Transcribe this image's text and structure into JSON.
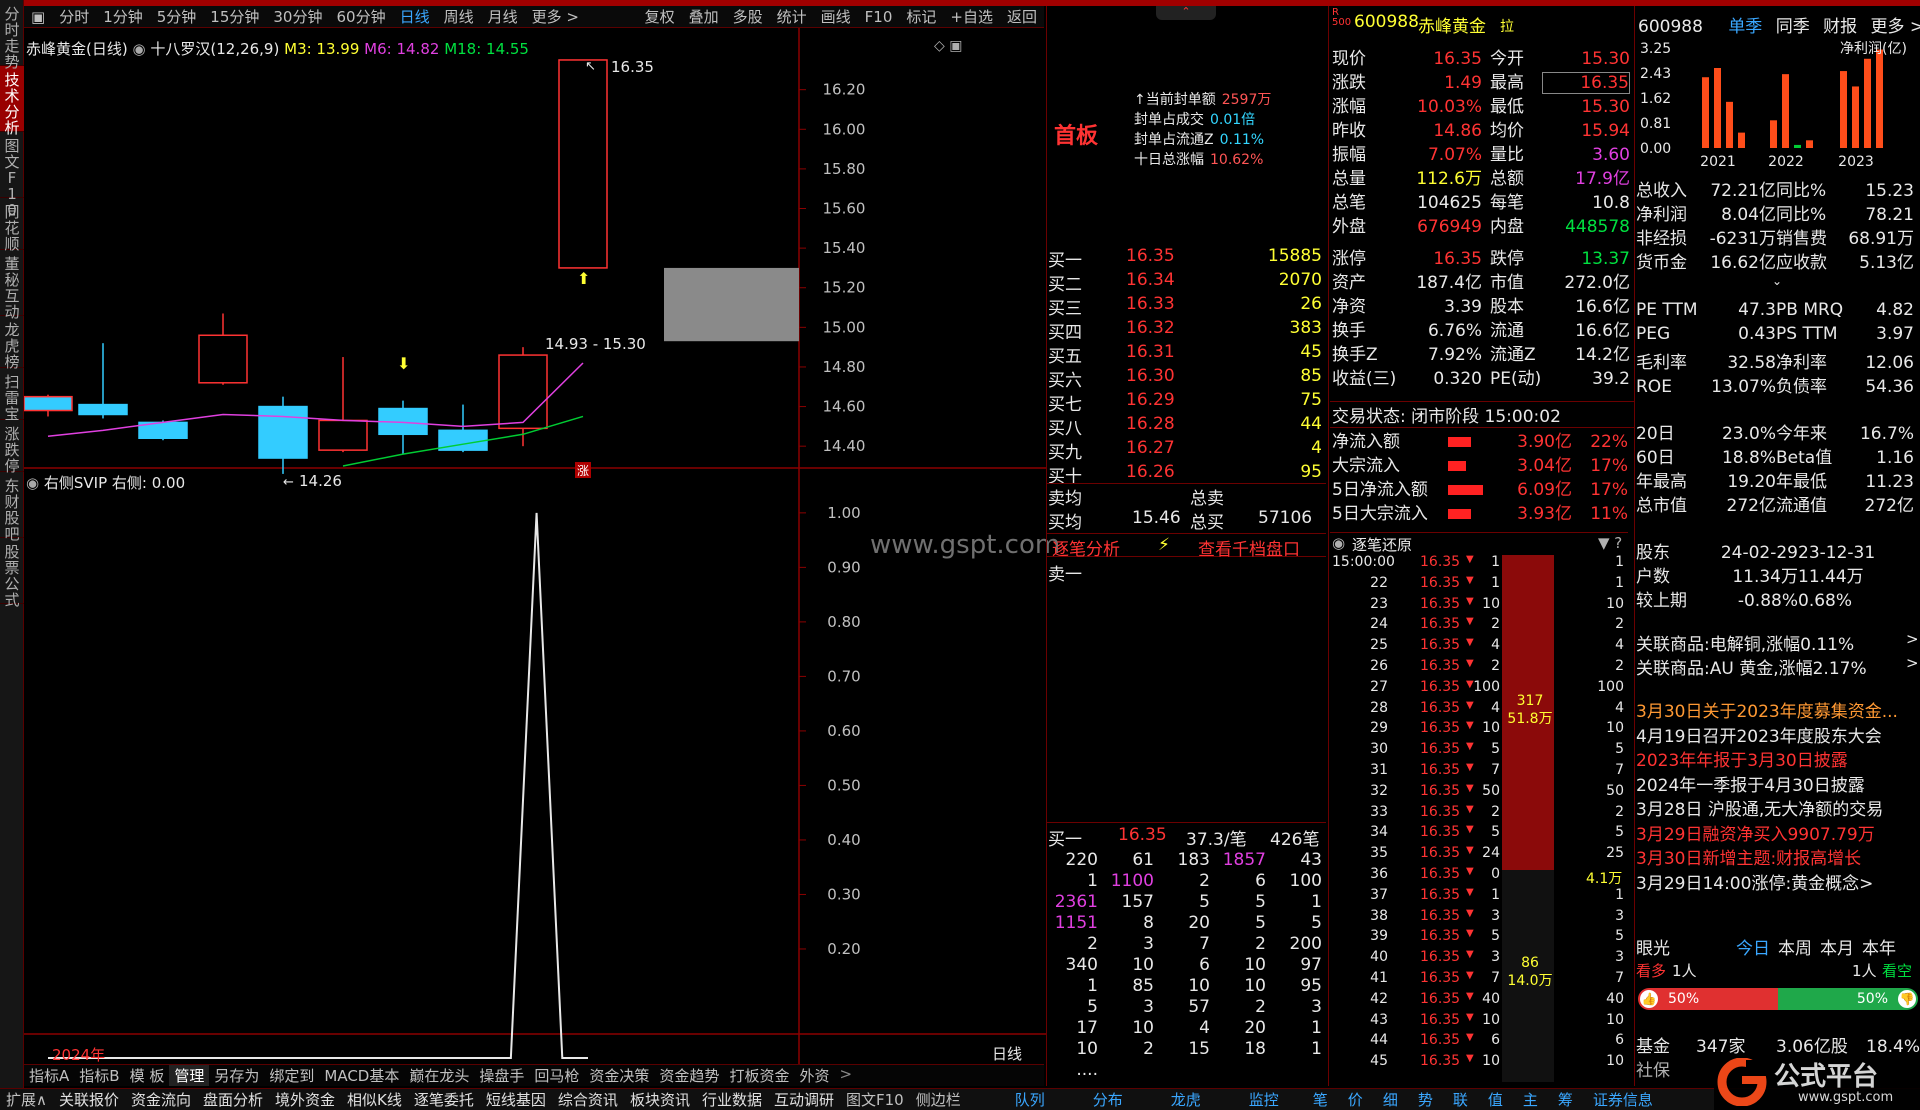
{
  "sidebar": [
    "分时走势",
    "技术分析",
    "图文F10",
    "同花顺",
    "董秘互动",
    "龙虎榜",
    "扫雷宝",
    "涨跌停",
    "东财股吧",
    "股票公式"
  ],
  "toolbar": {
    "periods": [
      "分时",
      "1分钟",
      "5分钟",
      "15分钟",
      "30分钟",
      "60分钟",
      "日线",
      "周线",
      "月线",
      "更多 >"
    ],
    "actions": [
      "复权",
      "叠加",
      "多股",
      "统计",
      "画线",
      "F10",
      "标记",
      "+自选",
      "返回"
    ]
  },
  "chart_header": {
    "title": "赤峰黄金(日线)",
    "indicator": "十八罗汉(12,26,9)",
    "m3": "M3: 13.99",
    "m6": "M6: 14.82",
    "m18": "M18: 14.55"
  },
  "chart_data": [
    {
      "type": "candlestick",
      "title": "赤峰黄金(日线)",
      "y_ticks": [
        "16.20",
        "16.00",
        "15.80",
        "15.60",
        "15.40",
        "15.20",
        "15.00",
        "14.80",
        "14.60",
        "14.40"
      ],
      "ylim": [
        14.31,
        16.37
      ],
      "candles": [
        {
          "open": 14.65,
          "close": 14.58,
          "high": 14.66,
          "low": 14.55
        },
        {
          "open": 14.61,
          "close": 14.56,
          "high": 14.92,
          "low": 14.54
        },
        {
          "open": 14.52,
          "close": 14.44,
          "high": 14.53,
          "low": 14.43
        },
        {
          "open": 14.72,
          "close": 14.96,
          "high": 15.07,
          "low": 14.71
        },
        {
          "open": 14.6,
          "close": 14.34,
          "high": 14.65,
          "low": 14.26
        },
        {
          "open": 14.38,
          "close": 14.53,
          "high": 14.85,
          "low": 14.37
        },
        {
          "open": 14.59,
          "close": 14.46,
          "high": 14.63,
          "low": 14.36
        },
        {
          "open": 14.48,
          "close": 14.38,
          "high": 14.61,
          "low": 14.37
        },
        {
          "open": 14.49,
          "close": 14.86,
          "high": 14.9,
          "low": 14.4
        },
        {
          "open": 15.3,
          "close": 16.35,
          "high": 16.35,
          "low": 15.3
        }
      ],
      "ma_lines": [
        {
          "name": "M6",
          "values": [
            14.45,
            14.48,
            14.52,
            14.56,
            14.55,
            14.53,
            14.52,
            14.5,
            14.52,
            14.82
          ]
        },
        {
          "name": "M18",
          "values": [
            null,
            null,
            null,
            null,
            null,
            14.3,
            14.36,
            14.41,
            14.46,
            14.55
          ]
        }
      ],
      "annotations": [
        "16.35",
        "14.93 - 15.30",
        "14.26",
        "涨"
      ]
    },
    {
      "type": "line",
      "title": "右侧SVIP",
      "readout": "右侧: 0.00",
      "y_ticks": [
        "1.00",
        "0.90",
        "0.80",
        "0.70",
        "0.60",
        "0.50",
        "0.40",
        "0.30",
        "0.20"
      ],
      "ylim": [
        0.0,
        1.0
      ],
      "x": [
        0,
        1,
        2,
        3,
        4,
        5,
        6,
        7,
        8,
        9,
        10,
        11,
        12,
        13,
        14,
        15,
        16,
        17,
        18,
        19,
        20,
        21
      ],
      "values": [
        0,
        0,
        0,
        0,
        0,
        0,
        0,
        0,
        0,
        0,
        0,
        0,
        0,
        0,
        0,
        0,
        0,
        0,
        0,
        1,
        0,
        0
      ]
    }
  ],
  "date_label": "2024年",
  "period_label": "日线",
  "watermark": "www.gspt.com",
  "bottom_tabs_1": [
    "指标A",
    "指标B",
    "模 板",
    "管理",
    "另存为",
    "绑定到",
    "MACD基本",
    "巅在龙头",
    "操盘手",
    "回马枪",
    "资金决策",
    "资金趋势",
    "打板资金",
    "外资"
  ],
  "bottom_tabs_2": [
    "扩展∧",
    "关联报价",
    "资金流向",
    "盘面分析",
    "境外资金",
    "相似K线",
    "逐笔委托",
    "短线基因",
    "综合资讯",
    "板块资讯",
    "行业数据",
    "互动调研",
    "图文F10",
    "侧边栏"
  ],
  "bottom_tabs_3": [
    "队列",
    "分布",
    "龙虎",
    "监控"
  ],
  "bottom_tabs_4": [
    "笔",
    "价",
    "细",
    "势",
    "联",
    "值",
    "主",
    "筹",
    "证券信息"
  ],
  "seal_info": {
    "board": "首板",
    "rows": [
      {
        "label": "当前封单额",
        "value": "2597万"
      },
      {
        "label": "封单占成交",
        "value": "0.01倍"
      },
      {
        "label": "封单占流通Z",
        "value": "0.11%"
      },
      {
        "label": "十日总涨幅",
        "value": "10.62%"
      }
    ]
  },
  "order_book": {
    "bids": [
      {
        "label": "买一",
        "price": "16.35",
        "vol": "15885"
      },
      {
        "label": "买二",
        "price": "16.34",
        "vol": "2070"
      },
      {
        "label": "买三",
        "price": "16.33",
        "vol": "26"
      },
      {
        "label": "买四",
        "price": "16.32",
        "vol": "383"
      },
      {
        "label": "买五",
        "price": "16.31",
        "vol": "45"
      },
      {
        "label": "买六",
        "price": "16.30",
        "vol": "85"
      },
      {
        "label": "买七",
        "price": "16.29",
        "vol": "75"
      },
      {
        "label": "买八",
        "price": "16.28",
        "vol": "44"
      },
      {
        "label": "买九",
        "price": "16.27",
        "vol": "4"
      },
      {
        "label": "买十",
        "price": "16.26",
        "vol": "95"
      }
    ],
    "sell_avg_label": "卖均",
    "sell_total_label": "总卖",
    "buy_avg_label": "买均",
    "buy_avg": "15.46",
    "buy_total_label": "总买",
    "buy_total": "57106",
    "tab_left": "逐笔分析",
    "tab_right": "查看千档盘口",
    "sell1": "卖一",
    "buy1_summary": {
      "label": "买一",
      "price": "16.35",
      "per": "37.3/笔",
      "count": "426笔"
    },
    "queue": [
      [
        "220",
        "61",
        "183",
        "1857",
        "43"
      ],
      [
        "1",
        "1100",
        "2",
        "6",
        "100"
      ],
      [
        "2361",
        "157",
        "5",
        "5",
        "1"
      ],
      [
        "1151",
        "8",
        "20",
        "5",
        "5"
      ],
      [
        "2",
        "3",
        "7",
        "2",
        "200"
      ],
      [
        "340",
        "10",
        "6",
        "10",
        "97"
      ],
      [
        "1",
        "85",
        "10",
        "10",
        "95"
      ],
      [
        "5",
        "3",
        "57",
        "2",
        "3"
      ],
      [
        "17",
        "10",
        "4",
        "20",
        "1"
      ],
      [
        "10",
        "2",
        "15",
        "18",
        "1"
      ],
      [
        "....",
        "",
        "",
        "",
        ""
      ]
    ]
  },
  "quote": {
    "code": "600988",
    "name": "赤峰黄金",
    "suffix": "拉",
    "tag_top": "R",
    "tag_bottom": "500",
    "rows": [
      [
        "现价",
        "16.35",
        "今开",
        "15.30"
      ],
      [
        "涨跌",
        "1.49",
        "最高",
        "16.35"
      ],
      [
        "涨幅",
        "10.03%",
        "最低",
        "15.30"
      ],
      [
        "昨收",
        "14.86",
        "均价",
        "15.94"
      ],
      [
        "振幅",
        "7.07%",
        "量比",
        "3.60"
      ],
      [
        "总量",
        "112.6万",
        "总额",
        "17.9亿"
      ],
      [
        "总笔",
        "104625",
        "每笔",
        "10.8"
      ],
      [
        "外盘",
        "676949",
        "内盘",
        "448578"
      ],
      [
        "涨停",
        "16.35",
        "跌停",
        "13.37"
      ],
      [
        "资产",
        "187.4亿",
        "市值",
        "272.0亿"
      ],
      [
        "净资",
        "3.39",
        "股本",
        "16.6亿"
      ],
      [
        "换手",
        "6.76%",
        "流通",
        "16.6亿"
      ],
      [
        "换手Z",
        "7.92%",
        "流通Z",
        "14.2亿"
      ],
      [
        "收益(三)",
        "0.320",
        "PE(动)",
        "39.2"
      ]
    ],
    "trade_status": "交易状态: 闭市阶段 15:00:02",
    "flows": [
      {
        "label": "净流入额",
        "value": "3.90亿",
        "pct": "22%",
        "bar": 0.45
      },
      {
        "label": "大宗流入",
        "value": "3.04亿",
        "pct": "17%",
        "bar": 0.35
      },
      {
        "label": "5日净流入额",
        "value": "6.09亿",
        "pct": "17%",
        "bar": 0.7
      },
      {
        "label": "5日大宗流入",
        "value": "3.93亿",
        "pct": "11%",
        "bar": 0.45
      }
    ]
  },
  "ticks": {
    "header": "逐笔还原",
    "rows": [
      [
        "15:00:00",
        "16.35",
        "1",
        "1"
      ],
      [
        "22",
        "16.35",
        "1",
        "1"
      ],
      [
        "23",
        "16.35",
        "10",
        "10"
      ],
      [
        "24",
        "16.35",
        "2",
        "2"
      ],
      [
        "25",
        "16.35",
        "4",
        "4"
      ],
      [
        "26",
        "16.35",
        "2",
        "2"
      ],
      [
        "27",
        "16.35",
        "100",
        "100"
      ],
      [
        "28",
        "16.35",
        "4",
        "4"
      ],
      [
        "29",
        "16.35",
        "10",
        "10"
      ],
      [
        "30",
        "16.35",
        "5",
        "5"
      ],
      [
        "31",
        "16.35",
        "7",
        "7"
      ],
      [
        "32",
        "16.35",
        "50",
        "50"
      ],
      [
        "33",
        "16.35",
        "2",
        "2"
      ],
      [
        "34",
        "16.35",
        "5",
        "5"
      ],
      [
        "35",
        "16.35",
        "24",
        "25"
      ],
      [
        "36",
        "16.35",
        "0",
        ""
      ],
      [
        "37",
        "16.35",
        "1",
        "1"
      ],
      [
        "38",
        "16.35",
        "3",
        "3"
      ],
      [
        "39",
        "16.35",
        "5",
        "5"
      ],
      [
        "40",
        "16.35",
        "3",
        "3"
      ],
      [
        "41",
        "16.35",
        "7",
        "7"
      ],
      [
        "42",
        "16.35",
        "40",
        "40"
      ],
      [
        "43",
        "16.35",
        "10",
        "10"
      ],
      [
        "44",
        "16.35",
        "6",
        "6"
      ],
      [
        "45",
        "16.35",
        "10",
        "10"
      ]
    ],
    "bar_labels": {
      "top_count": "317",
      "top_amount": "51.8万",
      "mid": "4.1万",
      "bot_count": "86",
      "bot_amount": "14.0万"
    }
  },
  "fundamentals": {
    "code": "600988",
    "tabs": [
      "单季",
      "同季",
      "财报",
      "更多 >"
    ],
    "chart": {
      "title": "净利润(亿)",
      "type": "bar",
      "y_ticks": [
        "3.25",
        "2.43",
        "1.62",
        "0.81",
        "0.00"
      ],
      "years": [
        "2021",
        "2022",
        "2023"
      ],
      "values": [
        2.3,
        2.6,
        1.5,
        0.5,
        0.9,
        2.4,
        0.1,
        0.25,
        2.5,
        2.0,
        2.9,
        3.2
      ],
      "ylim": [
        0,
        3.25
      ]
    },
    "rows": [
      [
        "总收入",
        "72.21亿",
        "同比%",
        "15.23"
      ],
      [
        "净利润",
        "8.04亿",
        "同比%",
        "78.21"
      ],
      [
        "非经损",
        "-6231万",
        "销售费",
        "68.91万"
      ],
      [
        "货币金",
        "16.62亿",
        "应收款",
        "5.13亿"
      ]
    ],
    "ratios": [
      [
        "PE TTM",
        "47.3",
        "PB MRQ",
        "4.82"
      ],
      [
        "PEG",
        "0.43",
        "PS TTM",
        "3.97"
      ],
      [
        "毛利率",
        "32.58",
        "净利率",
        "12.06"
      ],
      [
        "ROE",
        "13.07%",
        "负债率",
        "54.36"
      ]
    ],
    "perf": [
      [
        "20日",
        "23.0%",
        "今年来",
        "16.7%"
      ],
      [
        "60日",
        "18.8%",
        "Beta值",
        "1.16"
      ],
      [
        "年最高",
        "19.20",
        "年最低",
        "11.23"
      ],
      [
        "总市值",
        "272亿",
        "流通值",
        "272亿"
      ]
    ],
    "holders": [
      [
        "股东",
        "24-02-29",
        "23-12-31"
      ],
      [
        "户数",
        "11.34万",
        "11.44万"
      ],
      [
        "较上期",
        "-0.88%",
        "0.68%"
      ]
    ],
    "related": [
      "关联商品:电解铜,涨幅0.11%",
      "关联商品:AU 黄金,涨幅2.17%"
    ],
    "news": [
      {
        "text": "3月30日关于2023年度募集资金...",
        "color": "#ff9933"
      },
      {
        "text": "4月19日召开2023年度股东大会",
        "color": "#e8e8e8"
      },
      {
        "text": "2023年年报于3月30日披露",
        "color": "#ff3333"
      },
      {
        "text": "2024年一季报于4月30日披露",
        "color": "#e8e8e8"
      },
      {
        "text": "3月28日 沪股通,无大净额的交易",
        "color": "#e8e8e8"
      },
      {
        "text": "3月29日融资净买入9907.79万",
        "color": "#ff3333"
      },
      {
        "text": "3月30日新增主题:财报高增长",
        "color": "#ff3333"
      },
      {
        "text": "3月29日14:00涨停:黄金概念>",
        "color": "#e8e8e8"
      }
    ],
    "vision": {
      "label": "眼光",
      "tabs": [
        "今日",
        "本周",
        "本月",
        "本年"
      ],
      "bull": "看多",
      "bull_count": "1人",
      "bear_count": "1人",
      "bear": "看空",
      "bull_pct": "50%",
      "bear_pct": "50%"
    },
    "fund_row": [
      "基金",
      "347家",
      "3.06亿股",
      "18.4%"
    ],
    "social_row": "社保",
    "logo_text": "公式平台",
    "logo_url": "www.gspt.com"
  }
}
